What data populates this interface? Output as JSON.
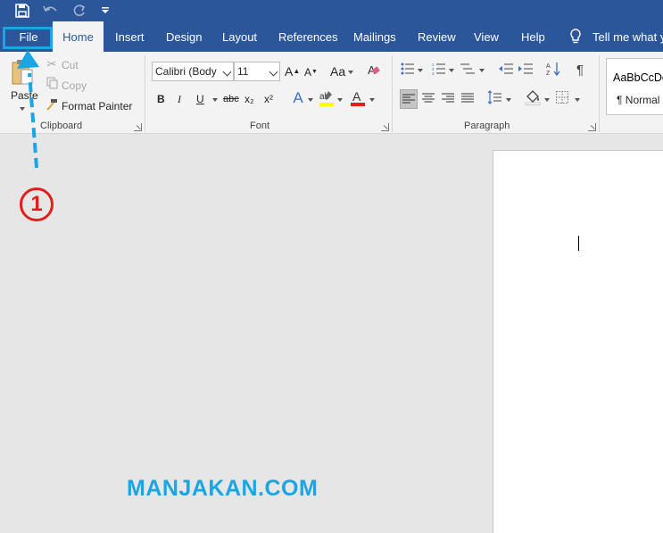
{
  "tabs": {
    "file": "File",
    "home": "Home",
    "insert": "Insert",
    "design": "Design",
    "layout": "Layout",
    "references": "References",
    "mailings": "Mailings",
    "review": "Review",
    "view": "View",
    "help": "Help",
    "tell_me": "Tell me what yo"
  },
  "clipboard": {
    "paste": "Paste",
    "cut": "Cut",
    "copy": "Copy",
    "format_painter": "Format Painter",
    "label": "Clipboard"
  },
  "font": {
    "name": "Calibri (Body",
    "size": "11",
    "change_case": "Aa",
    "bold": "B",
    "italic": "I",
    "underline": "U",
    "strikethrough": "abc",
    "subscript": "x₂",
    "superscript": "x²",
    "label": "Font"
  },
  "paragraph": {
    "label": "Paragraph",
    "pilcrow": "¶"
  },
  "styles": {
    "preview": "AaBbCcDc",
    "normal": "¶ Normal"
  },
  "annotation": {
    "step": "1",
    "watermark": "MANJAKAN.COM",
    "color": "#1aa6e4",
    "badge_color": "#e0201b"
  },
  "colors": {
    "ribbon_blue": "#2b579a",
    "highlight_yellow": "#ffff00",
    "font_red": "#e0201b"
  }
}
